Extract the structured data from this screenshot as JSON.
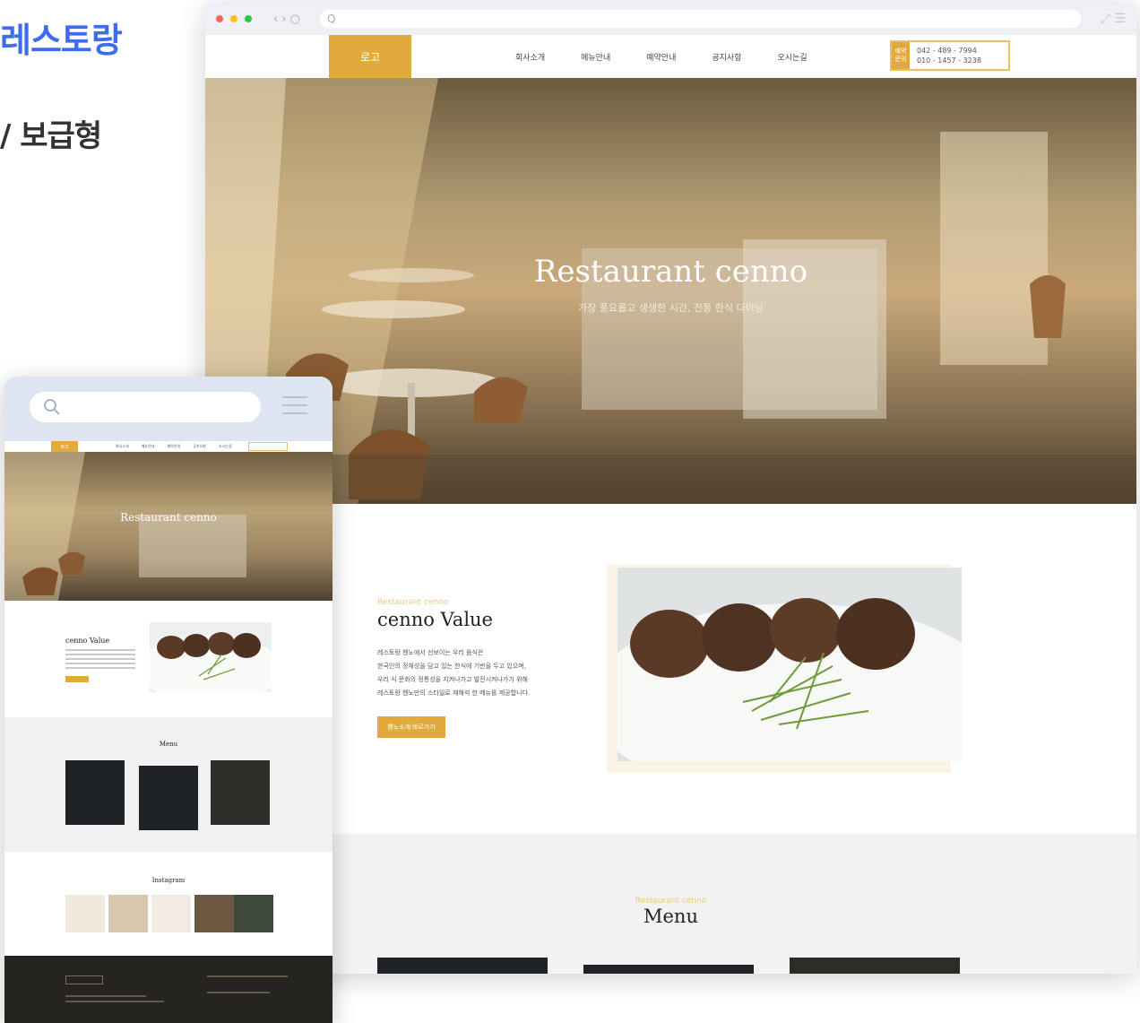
{
  "promo": {
    "title": "레스토랑",
    "subtitle": "/ 보급형"
  },
  "browser": {
    "search_glyph": "Q",
    "nav_icons": "‹ › ○"
  },
  "site": {
    "logo": "로고",
    "menu": [
      "회사소개",
      "메뉴안내",
      "예약안내",
      "공지사항",
      "오시는길"
    ],
    "phone_label": "예약 문의",
    "phone_numbers": [
      "042 - 489 - 7994",
      "010 - 1457 - 3238"
    ],
    "hero_title": "Restaurant cenno",
    "hero_subtitle": "가장 풍요롭고 생생한 시간, 전통 한식 다이닝",
    "value_kicker": "Restaurant cenno",
    "value_title": "cenno Value",
    "value_text": [
      "레스토랑 첸노에서 선보이는 우리 음식은",
      "한국인의 정체성을 담고 있는 한식에 기반을 두고 있으며,",
      "우리 식 문화의 정통성을 지켜나가고 발전시켜나가기 위해",
      "레스토랑 첸노만의 스타일로 재해석 한 메뉴를 제공합니다."
    ],
    "value_button": "첸노소개 바로가기",
    "menu_kicker": "Restaurant cenno",
    "menu_title": "Menu"
  },
  "mobile": {
    "logo": "로고",
    "hero_title": "Restaurant cenno",
    "value_title": "cenno Value",
    "menu_title": "Menu",
    "insta_title": "Instagram"
  },
  "colors": {
    "accent": "#e2aa3c",
    "promo_blue": "#3d6cf0",
    "footer": "#262420"
  }
}
